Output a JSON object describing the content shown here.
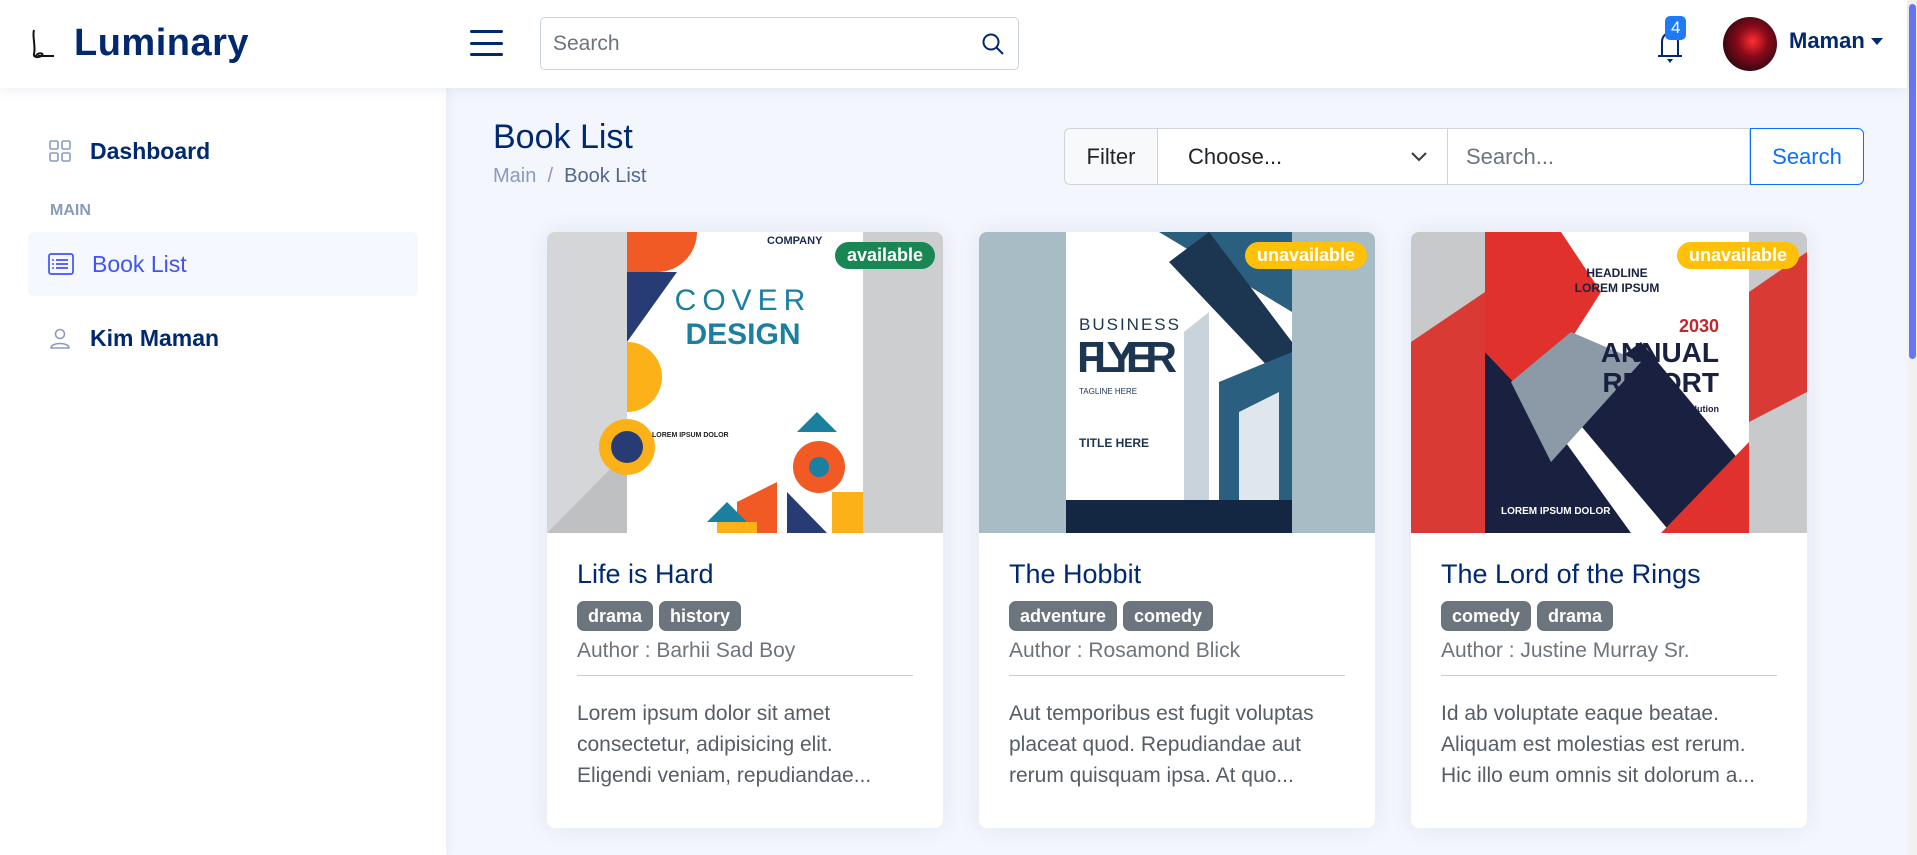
{
  "header": {
    "brand": "Luminary",
    "search_placeholder": "Search",
    "notifications_count": "4",
    "user_name": "Maman"
  },
  "sidebar": {
    "items": [
      {
        "label": "Dashboard",
        "icon": "grid-icon"
      },
      {
        "label": "Book List",
        "icon": "list-icon",
        "active": true
      },
      {
        "label": "Kim Maman",
        "icon": "person-icon"
      }
    ],
    "heading": "MAIN"
  },
  "page": {
    "title": "Book List",
    "breadcrumb": [
      "Main",
      "Book List"
    ]
  },
  "filter": {
    "label": "Filter",
    "select_value": "Choose...",
    "search_placeholder": "Search...",
    "button": "Search"
  },
  "colors": {
    "available": "#198754",
    "unavailable": "#ffc107",
    "primary": "#012970",
    "accent": "#4154f1"
  },
  "books": [
    {
      "title": "Life is Hard",
      "status": "available",
      "tags": [
        "drama",
        "history"
      ],
      "author": "Author : Barhii Sad Boy",
      "description": "Lorem ipsum dolor sit amet consectetur, adipisicing elit. Eligendi veniam, repudiandae...",
      "cover_text": [
        "COMPANY",
        "COVER",
        "DESIGN",
        "LOREM IPSUM DOLOR"
      ]
    },
    {
      "title": "The Hobbit",
      "status": "unavailable",
      "tags": [
        "adventure",
        "comedy"
      ],
      "author": "Author : Rosamond Blick",
      "description": "Aut temporibus est fugit voluptas placeat quod. Repudiandae aut rerum quisquam ipsa. At quo...",
      "cover_text": [
        "BUSINESS",
        "FLYER",
        "TAGLINE HERE",
        "TITLE HERE"
      ]
    },
    {
      "title": "The Lord of the Rings",
      "status": "unavailable",
      "tags": [
        "comedy",
        "drama"
      ],
      "author": "Author : Justine Murray Sr.",
      "description": "Id ab voluptate eaque beatae. Aliquam est molestias est rerum. Hic illo eum omnis sit dolorum a...",
      "cover_text": [
        "HEADLINE",
        "LOREM IPSUM",
        "2030",
        "ANNUAL",
        "REPORT",
        "Global Business Solution",
        "LOREM IPSUM DOLOR"
      ]
    }
  ]
}
